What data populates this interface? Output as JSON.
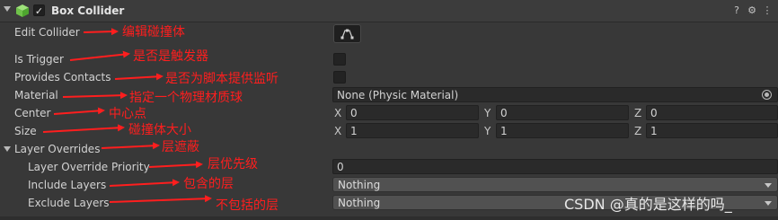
{
  "component": {
    "title": "Box Collider",
    "enabled_check": "✓",
    "icon_help": "?",
    "icon_settings": "⚙",
    "icon_more": "⋮"
  },
  "fields": {
    "edit_collider": "Edit Collider",
    "is_trigger": "Is Trigger",
    "provides_contacts": "Provides Contacts",
    "material": {
      "label": "Material",
      "value": "None (Physic Material)"
    },
    "center": {
      "label": "Center",
      "x": "0",
      "y": "0",
      "z": "0"
    },
    "size": {
      "label": "Size",
      "x": "1",
      "y": "1",
      "z": "1"
    },
    "axes": {
      "x": "X",
      "y": "Y",
      "z": "Z"
    },
    "layer_overrides": "Layer Overrides",
    "layer_override_priority": {
      "label": "Layer Override Priority",
      "value": "0"
    },
    "include_layers": {
      "label": "Include Layers",
      "value": "Nothing"
    },
    "exclude_layers": {
      "label": "Exclude Layers",
      "value": "Nothing"
    }
  },
  "annotations": {
    "edit_collider": "编辑碰撞体",
    "is_trigger": "是否是触发器",
    "provides_contacts": "是否为脚本提供监听",
    "material": "指定一个物理材质球",
    "center": "中心点",
    "size": "碰撞体大小",
    "layer_overrides": "层遮蔽",
    "layer_override_priority": "层优先级",
    "include_layers": "包含的层",
    "exclude_layers": "不包括的层"
  },
  "watermark": "CSDN @真的是这样的吗_",
  "colors": {
    "annotation": "#ff1e1e",
    "background": "#383838",
    "header": "#3c3c3c"
  }
}
